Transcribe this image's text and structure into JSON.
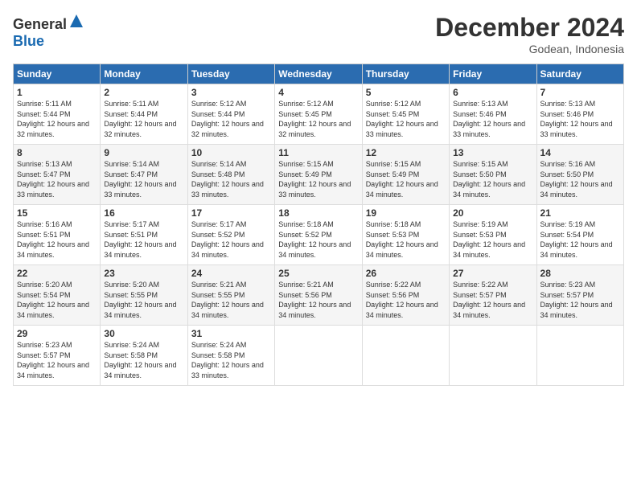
{
  "header": {
    "logo_general": "General",
    "logo_blue": "Blue",
    "month": "December 2024",
    "location": "Godean, Indonesia"
  },
  "weekdays": [
    "Sunday",
    "Monday",
    "Tuesday",
    "Wednesday",
    "Thursday",
    "Friday",
    "Saturday"
  ],
  "weeks": [
    [
      {
        "day": "1",
        "sunrise": "5:11 AM",
        "sunset": "5:44 PM",
        "daylight": "12 hours and 32 minutes."
      },
      {
        "day": "2",
        "sunrise": "5:11 AM",
        "sunset": "5:44 PM",
        "daylight": "12 hours and 32 minutes."
      },
      {
        "day": "3",
        "sunrise": "5:12 AM",
        "sunset": "5:44 PM",
        "daylight": "12 hours and 32 minutes."
      },
      {
        "day": "4",
        "sunrise": "5:12 AM",
        "sunset": "5:45 PM",
        "daylight": "12 hours and 32 minutes."
      },
      {
        "day": "5",
        "sunrise": "5:12 AM",
        "sunset": "5:45 PM",
        "daylight": "12 hours and 33 minutes."
      },
      {
        "day": "6",
        "sunrise": "5:13 AM",
        "sunset": "5:46 PM",
        "daylight": "12 hours and 33 minutes."
      },
      {
        "day": "7",
        "sunrise": "5:13 AM",
        "sunset": "5:46 PM",
        "daylight": "12 hours and 33 minutes."
      }
    ],
    [
      {
        "day": "8",
        "sunrise": "5:13 AM",
        "sunset": "5:47 PM",
        "daylight": "12 hours and 33 minutes."
      },
      {
        "day": "9",
        "sunrise": "5:14 AM",
        "sunset": "5:47 PM",
        "daylight": "12 hours and 33 minutes."
      },
      {
        "day": "10",
        "sunrise": "5:14 AM",
        "sunset": "5:48 PM",
        "daylight": "12 hours and 33 minutes."
      },
      {
        "day": "11",
        "sunrise": "5:15 AM",
        "sunset": "5:49 PM",
        "daylight": "12 hours and 33 minutes."
      },
      {
        "day": "12",
        "sunrise": "5:15 AM",
        "sunset": "5:49 PM",
        "daylight": "12 hours and 34 minutes."
      },
      {
        "day": "13",
        "sunrise": "5:15 AM",
        "sunset": "5:50 PM",
        "daylight": "12 hours and 34 minutes."
      },
      {
        "day": "14",
        "sunrise": "5:16 AM",
        "sunset": "5:50 PM",
        "daylight": "12 hours and 34 minutes."
      }
    ],
    [
      {
        "day": "15",
        "sunrise": "5:16 AM",
        "sunset": "5:51 PM",
        "daylight": "12 hours and 34 minutes."
      },
      {
        "day": "16",
        "sunrise": "5:17 AM",
        "sunset": "5:51 PM",
        "daylight": "12 hours and 34 minutes."
      },
      {
        "day": "17",
        "sunrise": "5:17 AM",
        "sunset": "5:52 PM",
        "daylight": "12 hours and 34 minutes."
      },
      {
        "day": "18",
        "sunrise": "5:18 AM",
        "sunset": "5:52 PM",
        "daylight": "12 hours and 34 minutes."
      },
      {
        "day": "19",
        "sunrise": "5:18 AM",
        "sunset": "5:53 PM",
        "daylight": "12 hours and 34 minutes."
      },
      {
        "day": "20",
        "sunrise": "5:19 AM",
        "sunset": "5:53 PM",
        "daylight": "12 hours and 34 minutes."
      },
      {
        "day": "21",
        "sunrise": "5:19 AM",
        "sunset": "5:54 PM",
        "daylight": "12 hours and 34 minutes."
      }
    ],
    [
      {
        "day": "22",
        "sunrise": "5:20 AM",
        "sunset": "5:54 PM",
        "daylight": "12 hours and 34 minutes."
      },
      {
        "day": "23",
        "sunrise": "5:20 AM",
        "sunset": "5:55 PM",
        "daylight": "12 hours and 34 minutes."
      },
      {
        "day": "24",
        "sunrise": "5:21 AM",
        "sunset": "5:55 PM",
        "daylight": "12 hours and 34 minutes."
      },
      {
        "day": "25",
        "sunrise": "5:21 AM",
        "sunset": "5:56 PM",
        "daylight": "12 hours and 34 minutes."
      },
      {
        "day": "26",
        "sunrise": "5:22 AM",
        "sunset": "5:56 PM",
        "daylight": "12 hours and 34 minutes."
      },
      {
        "day": "27",
        "sunrise": "5:22 AM",
        "sunset": "5:57 PM",
        "daylight": "12 hours and 34 minutes."
      },
      {
        "day": "28",
        "sunrise": "5:23 AM",
        "sunset": "5:57 PM",
        "daylight": "12 hours and 34 minutes."
      }
    ],
    [
      {
        "day": "29",
        "sunrise": "5:23 AM",
        "sunset": "5:57 PM",
        "daylight": "12 hours and 34 minutes."
      },
      {
        "day": "30",
        "sunrise": "5:24 AM",
        "sunset": "5:58 PM",
        "daylight": "12 hours and 34 minutes."
      },
      {
        "day": "31",
        "sunrise": "5:24 AM",
        "sunset": "5:58 PM",
        "daylight": "12 hours and 33 minutes."
      },
      null,
      null,
      null,
      null
    ]
  ]
}
